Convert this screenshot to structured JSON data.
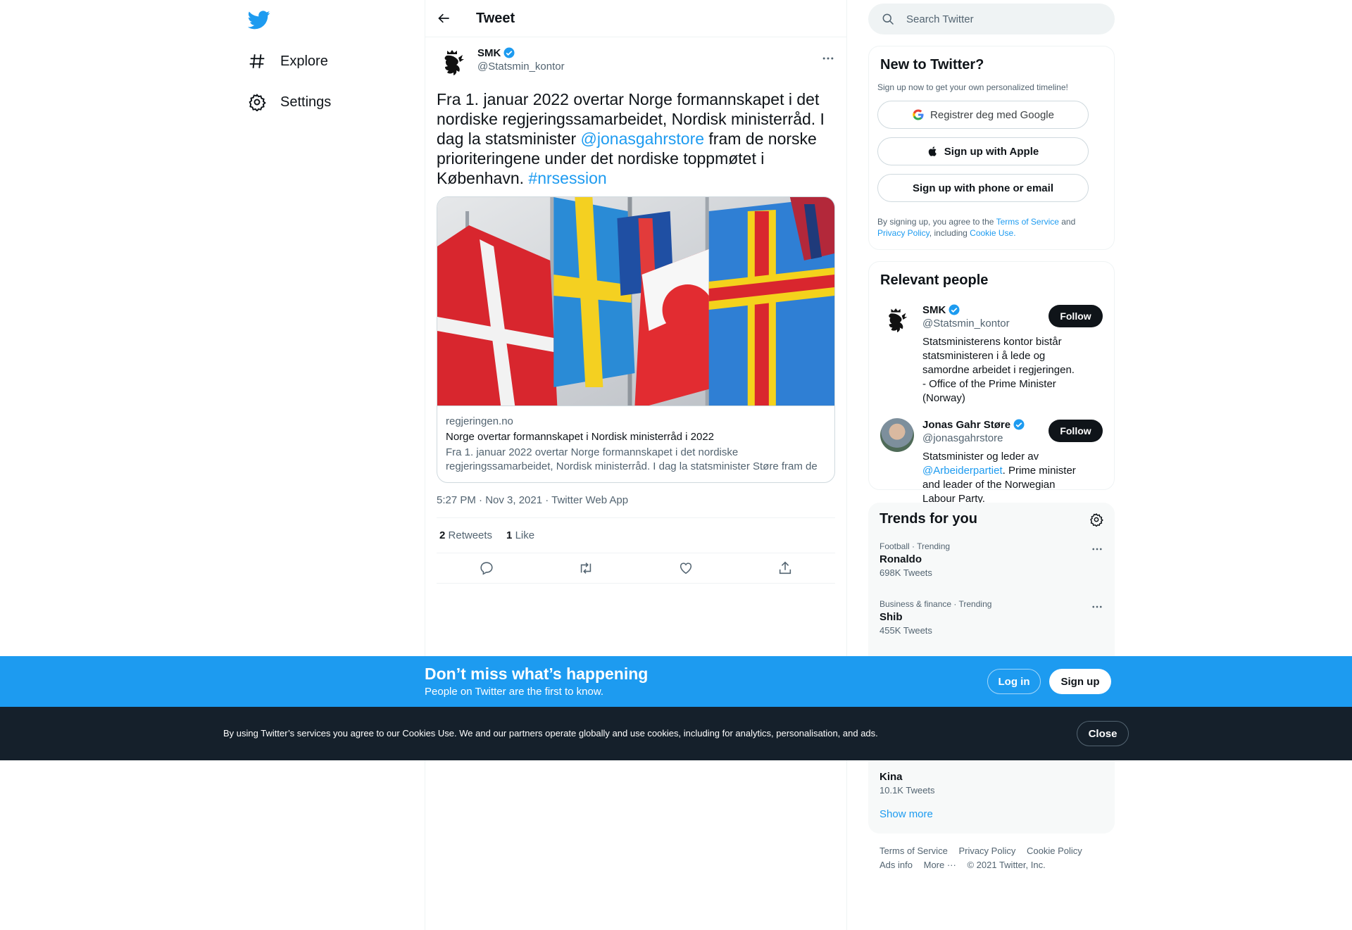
{
  "nav": {
    "items": [
      {
        "label": "Explore",
        "icon": "hashtag-icon"
      },
      {
        "label": "Settings",
        "icon": "gear-icon"
      }
    ]
  },
  "header": {
    "title": "Tweet"
  },
  "tweet": {
    "author_name": "SMK",
    "author_handle": "@Statsmin_kontor",
    "text_part1": "Fra 1. januar 2022 overtar Norge formannskapet i det nordiske regjeringssamarbeidet, Nordisk ministerråd. I dag la statsminister ",
    "mention": "@jonasgahrstore",
    "text_part2": " fram de norske prioriteringene under det nordiske toppmøtet i København. ",
    "hashtag": "#nrsession",
    "card": {
      "domain": "regjeringen.no",
      "title": "Norge overtar formannskapet i Nordisk ministerråd i 2022",
      "description": "Fra 1. januar 2022 overtar Norge formannskapet i det nordiske regjeringssamarbeidet, Nordisk ministerråd. I dag la statsminister Støre fram de norske prioriteringene under det nordiske toppmøtet i København."
    },
    "meta": "5:27 PM · Nov 3, 2021 · Twitter Web App",
    "retweets_count": "2",
    "retweets_label": "Retweets",
    "likes_count": "1",
    "likes_label": "Like"
  },
  "search": {
    "placeholder": "Search Twitter"
  },
  "signup_panel": {
    "title": "New to Twitter?",
    "subtitle": "Sign up now to get your own personalized timeline!",
    "google_label": "Registrer deg med Google",
    "apple_label": "Sign up with Apple",
    "phone_label": "Sign up with phone or email",
    "legal_prefix": "By signing up, you agree to the ",
    "terms": "Terms of Service",
    "and": " and",
    "privacy": "Privacy Policy",
    "including": ", including ",
    "cookie": "Cookie Use."
  },
  "people_panel": {
    "title": "Relevant people",
    "people": [
      {
        "name": "SMK",
        "handle": "@Statsmin_kontor",
        "follow": "Follow",
        "bio": "Statsministerens kontor bistår statsministeren i å lede og samordne arbeidet i regjeringen. - Office of the Prime Minister (Norway)"
      },
      {
        "name": "Jonas Gahr Støre",
        "handle": "@jonasgahrstore",
        "follow": "Follow",
        "bio_prefix": "Statsminister og leder av ",
        "bio_mention": "@Arbeiderpartiet",
        "bio_suffix": ". Prime minister and leader of the Norwegian Labour Party."
      }
    ]
  },
  "trends_panel": {
    "title": "Trends for you",
    "trends": [
      {
        "category": "Football · Trending",
        "name": "Ronaldo",
        "count": "698K Tweets"
      },
      {
        "category": "Business & finance · Trending",
        "name": "Shib",
        "count": "455K Tweets"
      },
      {
        "name": "Kina",
        "count": "10.1K Tweets"
      }
    ],
    "show_more": "Show more"
  },
  "footer": {
    "links": [
      "Terms of Service",
      "Privacy Policy",
      "Cookie Policy",
      "Ads info",
      "More ···",
      "© 2021 Twitter, Inc."
    ]
  },
  "happening_bar": {
    "title": "Don’t miss what’s happening",
    "subtitle": "People on Twitter are the first to know.",
    "login": "Log in",
    "signup": "Sign up"
  },
  "cookie_bar": {
    "text": "By using Twitter’s services you agree to our Cookies Use. We and our partners operate globally and use cookies, including for analytics, personalisation, and ads.",
    "close": "Close"
  },
  "colors": {
    "accent": "#1d9bf0",
    "dark": "#0f1419",
    "muted": "#536471",
    "cookie_bg": "#15202b"
  }
}
